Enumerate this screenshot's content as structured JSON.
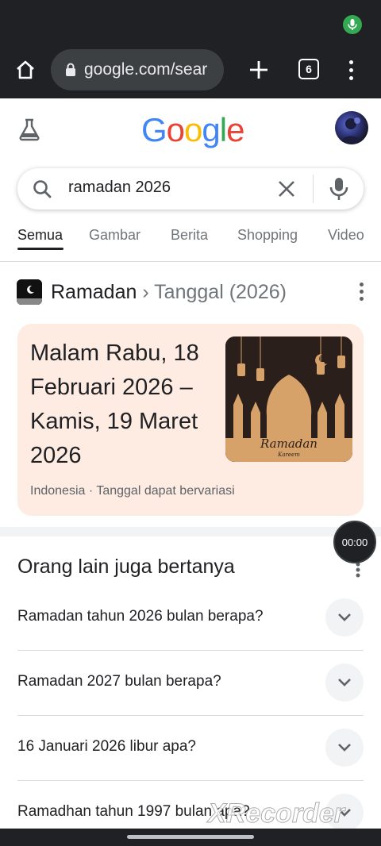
{
  "browser": {
    "url": "google.com/sear",
    "tab_count": "6"
  },
  "google": {
    "logo_letters": [
      "G",
      "o",
      "o",
      "g",
      "l",
      "e"
    ],
    "logo_colors": [
      "#4285F4",
      "#EA4335",
      "#FBBC05",
      "#4285F4",
      "#34A853",
      "#EA4335"
    ]
  },
  "search": {
    "query": "ramadan 2026"
  },
  "tabs": [
    "Semua",
    "Gambar",
    "Berita",
    "Shopping",
    "Video"
  ],
  "result": {
    "title_main": "Ramadan",
    "title_sub": "› Tanggal (2026)",
    "date_text": "Malam Rabu, 18 Februari 2026 – Kamis, 19 Maret 2026",
    "note": "Indonesia · Tanggal dapat bervariasi",
    "image_label": "Ramadan",
    "image_sublabel": "Kareem",
    "card_color": "#feece2"
  },
  "timer": "00:00",
  "paa": {
    "title": "Orang lain juga bertanya",
    "questions": [
      "Ramadan tahun 2026 bulan berapa?",
      "Ramadan 2027 bulan berapa?",
      "16 Januari 2026 libur apa?",
      "Ramadhan tahun 1997 bulan apa?"
    ]
  },
  "watermark": "XRecorder"
}
